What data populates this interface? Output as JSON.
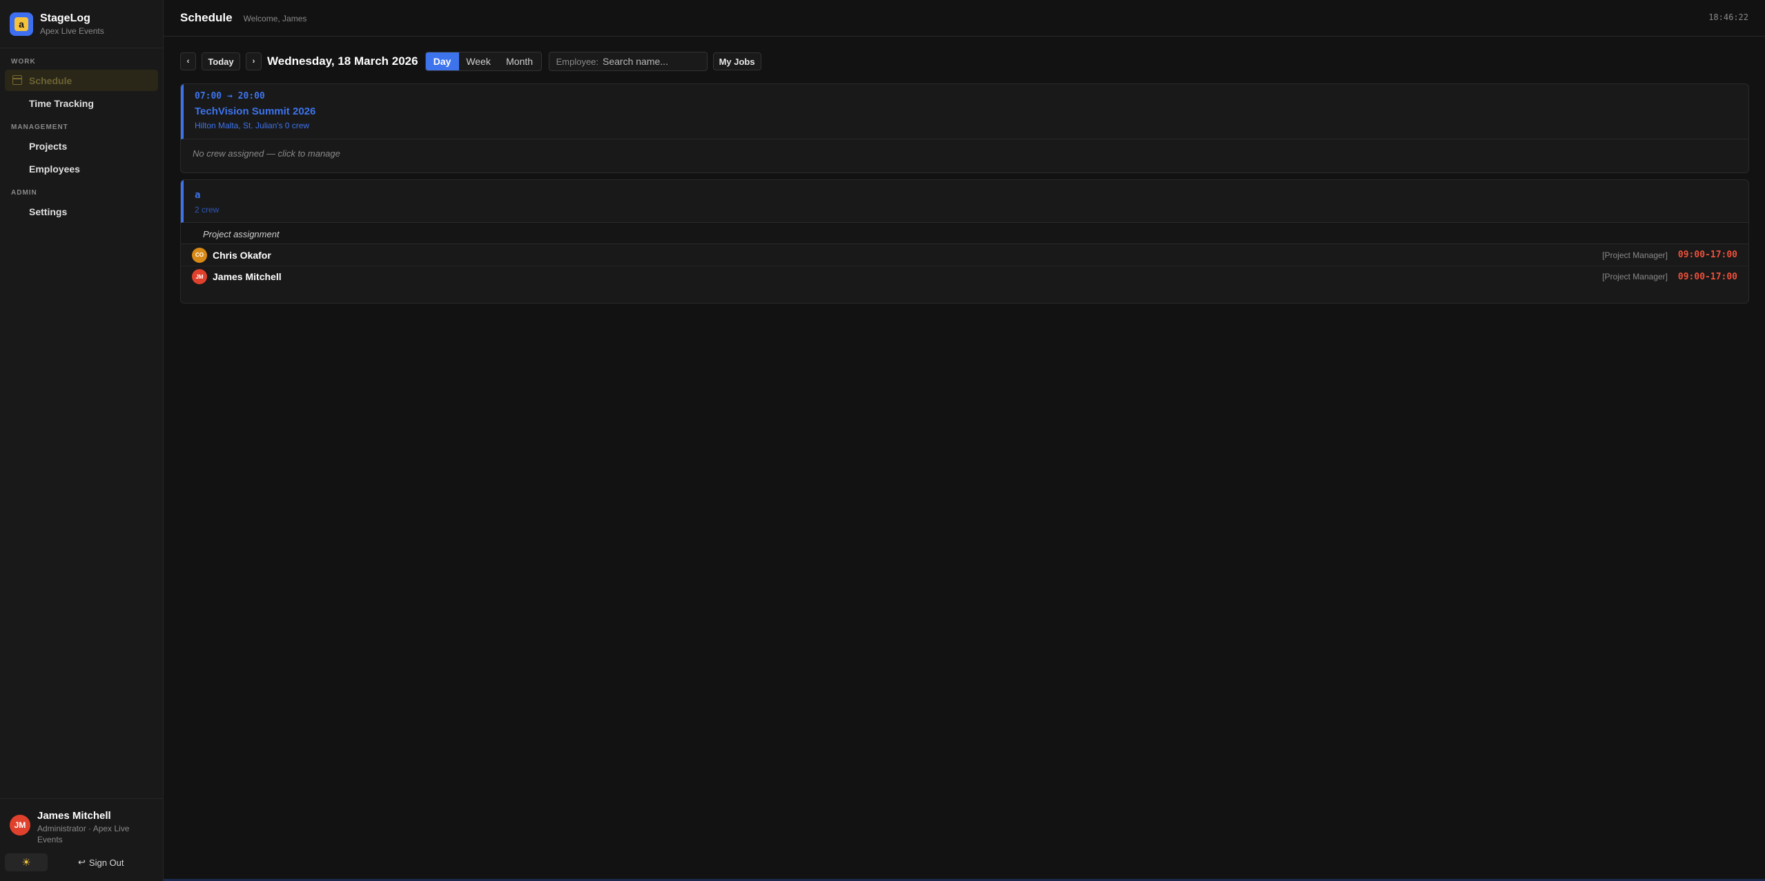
{
  "brand": {
    "name": "StageLog",
    "subtitle": "Apex Live Events",
    "logo_letter": "a"
  },
  "sidebar": {
    "sections": [
      {
        "label": "WORK",
        "items": [
          {
            "label": "Schedule",
            "active": true,
            "icon": "calendar-icon"
          },
          {
            "label": "Time Tracking"
          }
        ]
      },
      {
        "label": "MANAGEMENT",
        "items": [
          {
            "label": "Projects"
          },
          {
            "label": "Employees"
          }
        ]
      },
      {
        "label": "ADMIN",
        "items": [
          {
            "label": "Settings"
          }
        ]
      }
    ],
    "user": {
      "initials": "JM",
      "name": "James Mitchell",
      "role": "Administrator · Apex Live Events"
    },
    "theme_icon": "sun-icon",
    "sign_out": "Sign Out"
  },
  "header": {
    "title": "Schedule",
    "welcome": "Welcome, James",
    "clock": "18:46:22"
  },
  "toolbar": {
    "prev": "‹",
    "next": "›",
    "today": "Today",
    "date": "Wednesday, 18 March 2026",
    "views": [
      "Day",
      "Week",
      "Month"
    ],
    "active_view": "Day",
    "employee_label": "Employee:",
    "employee_placeholder": "Search name...",
    "my_jobs": "My Jobs"
  },
  "events": [
    {
      "time": "07:00 → 20:00",
      "title": "TechVision Summit 2026",
      "location": "Hilton Malta, St. Julian's",
      "crew_count": "0 crew",
      "empty_note": "No crew assigned — click to manage"
    }
  ],
  "projects": [
    {
      "name": "a",
      "crew_count": "2 crew",
      "assignment_label": "Project assignment",
      "crew": [
        {
          "initials": "CO",
          "name": "Chris Okafor",
          "role": "[Project Manager]",
          "time": "09:00-17:00",
          "color": "#d98a16"
        },
        {
          "initials": "JM",
          "name": "James Mitchell",
          "role": "[Project Manager]",
          "time": "09:00-17:00",
          "color": "#e0412c"
        }
      ]
    }
  ],
  "colors": {
    "accent": "#3d74ee",
    "time_red": "#f0503a",
    "background": "#121212"
  }
}
